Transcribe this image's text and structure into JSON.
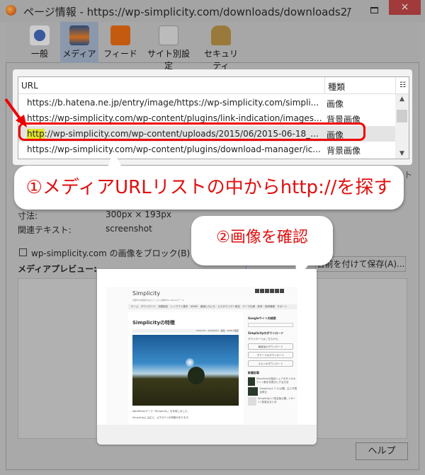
{
  "window": {
    "title": "ページ情報 - https://wp-simplicity.com/downloads/downloads2/",
    "minimize": "–",
    "close": "×"
  },
  "toolbar": [
    {
      "label": "一般",
      "icon": "info-icon"
    },
    {
      "label": "メディア",
      "icon": "media-icon",
      "selected": true
    },
    {
      "label": "フィード",
      "icon": "rss-icon"
    },
    {
      "label": "サイト別設定",
      "icon": "permissions-icon"
    },
    {
      "label": "セキュリティ",
      "icon": "lock-icon"
    }
  ],
  "list": {
    "col_url": "URL",
    "col_type": "種類",
    "picker": "☷",
    "rows": [
      {
        "url": "https://b.hatena.ne.jp/entry/image/https://wp-simplicity.com/simpli...",
        "type": "画像"
      },
      {
        "url": "https://wp-simplicity.com/wp-content/plugins/link-indication/images...",
        "type": "背景画像"
      },
      {
        "url_hl": "http",
        "url_rest": "://wp-simplicity.com/wp-content/uploads/2015/06/2015-06-18_...",
        "type": "画像"
      },
      {
        "url": "https://wp-simplicity.com/wp-content/plugins/download-manager/ic...",
        "type": "背景画像"
      }
    ]
  },
  "callouts": {
    "one": "①メディアURLリストの中からhttp://を探す",
    "two": "②画像を確認"
  },
  "details": {
    "dim_label": "寸法:",
    "dim_value": "300px × 193px",
    "alt_label": "関連テキスト:",
    "alt_value": "screenshot",
    "partial": "ト"
  },
  "block_checkbox": "wp-simplicity.com の画像をブロック(B)",
  "preview_label": "メディアプレビュー:",
  "save_button": "名前を付けて保存(A)...",
  "help_button": "ヘルプ",
  "preview_site": {
    "brand": "Simplicity",
    "tagline": "内部SEO施策済みのシンプルな無料WordPressテーマ",
    "nav": "ホーム　ダウンロード　初期設定　レイアウト基本　NEWS　最適いろいろ　カスタマイザー設定　テーマ仕様　参考・技術情報　サポート",
    "heading": "Simplicityの特徴",
    "meta": "2014/7/9　2015/6/12　編集　WLWで編集",
    "p1": "WordPressテーマ「Simplicity」を作成しました。",
    "p2": "Simplicityには主に、以下の7つの特徴があります。",
    "search_title": "Googleサイト内検索",
    "dl_title": "Simplicityのダウンロード",
    "dl_text": "ダウンロードはこちらから。",
    "buttons": [
      "最新版のダウンロード",
      "子テーマのダウンロード",
      "スキンのダウンロード"
    ],
    "recent_title": "新着記事",
    "recent": [
      "Simplicityの独自シェアボタンのカウント数を非表示にする方法",
      "Simplicity1.7.11公開。主に不具合修正",
      "Simplicity1.7安定版公開。1.6～1.7変更点まとめ"
    ]
  }
}
